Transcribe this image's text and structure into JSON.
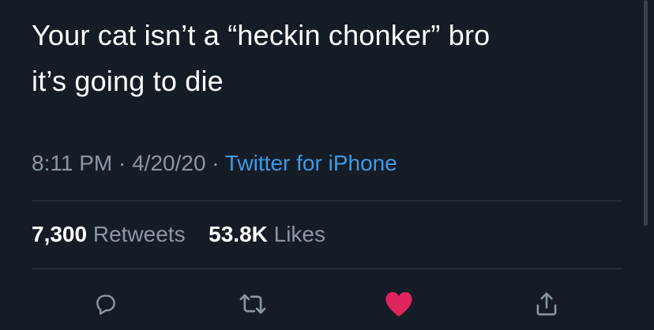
{
  "tweet": {
    "text": "Your cat isn’t a “heckin chonker” bro\nit’s going to die",
    "time": "8:11 PM",
    "date": "4/20/20",
    "separator": "·",
    "source": "Twitter for iPhone"
  },
  "stats": {
    "retweets_count": "7,300",
    "retweets_label": "Retweets",
    "likes_count": "53.8K",
    "likes_label": "Likes"
  },
  "actions": {
    "reply_icon": "reply-icon",
    "retweet_icon": "retweet-icon",
    "like_icon": "heart-icon",
    "like_active": true,
    "share_icon": "share-icon"
  },
  "colors": {
    "background": "#151c26",
    "text": "#ffffff",
    "secondary": "#8a97a3",
    "link": "#3d9ae8",
    "like": "#e0245e",
    "divider": "#2e3945"
  }
}
